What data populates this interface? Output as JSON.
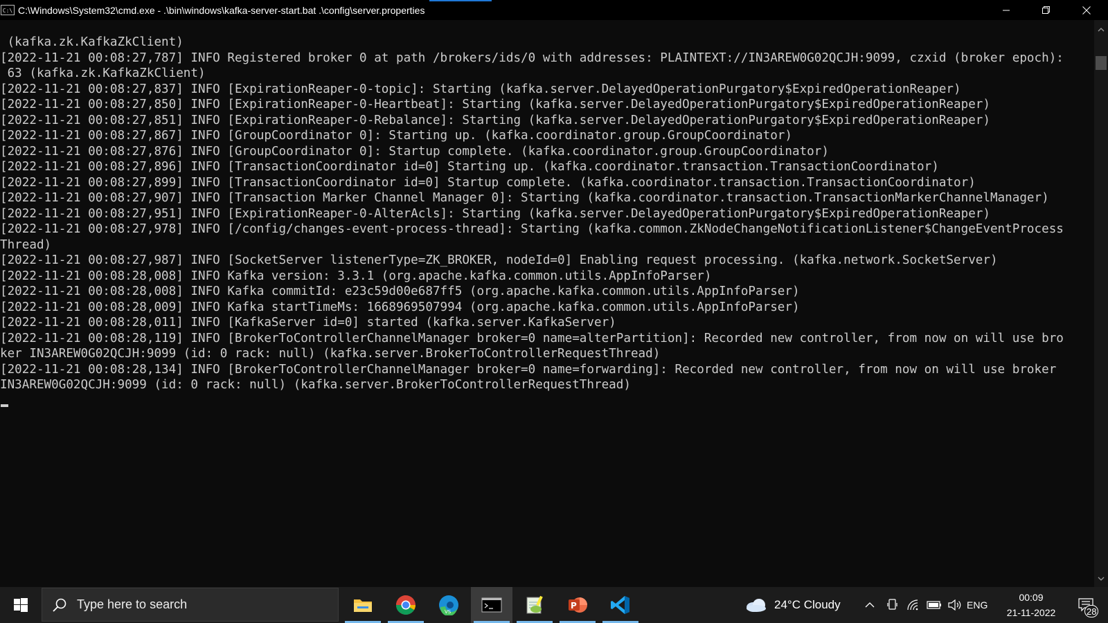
{
  "window": {
    "title": "C:\\Windows\\System32\\cmd.exe - .\\bin\\windows\\kafka-server-start.bat  .\\config\\server.properties",
    "icon_text": "C:\\"
  },
  "terminal": {
    "text": " (kafka.zk.KafkaZkClient)\n[2022-11-21 00:08:27,787] INFO Registered broker 0 at path /brokers/ids/0 with addresses: PLAINTEXT://IN3AREW0G02QCJH:9099, czxid (broker epoch):\n 63 (kafka.zk.KafkaZkClient)\n[2022-11-21 00:08:27,837] INFO [ExpirationReaper-0-topic]: Starting (kafka.server.DelayedOperationPurgatory$ExpiredOperationReaper)\n[2022-11-21 00:08:27,850] INFO [ExpirationReaper-0-Heartbeat]: Starting (kafka.server.DelayedOperationPurgatory$ExpiredOperationReaper)\n[2022-11-21 00:08:27,851] INFO [ExpirationReaper-0-Rebalance]: Starting (kafka.server.DelayedOperationPurgatory$ExpiredOperationReaper)\n[2022-11-21 00:08:27,867] INFO [GroupCoordinator 0]: Starting up. (kafka.coordinator.group.GroupCoordinator)\n[2022-11-21 00:08:27,876] INFO [GroupCoordinator 0]: Startup complete. (kafka.coordinator.group.GroupCoordinator)\n[2022-11-21 00:08:27,896] INFO [TransactionCoordinator id=0] Starting up. (kafka.coordinator.transaction.TransactionCoordinator)\n[2022-11-21 00:08:27,899] INFO [TransactionCoordinator id=0] Startup complete. (kafka.coordinator.transaction.TransactionCoordinator)\n[2022-11-21 00:08:27,907] INFO [Transaction Marker Channel Manager 0]: Starting (kafka.coordinator.transaction.TransactionMarkerChannelManager)\n[2022-11-21 00:08:27,951] INFO [ExpirationReaper-0-AlterAcls]: Starting (kafka.server.DelayedOperationPurgatory$ExpiredOperationReaper)\n[2022-11-21 00:08:27,978] INFO [/config/changes-event-process-thread]: Starting (kafka.common.ZkNodeChangeNotificationListener$ChangeEventProcess\nThread)\n[2022-11-21 00:08:27,987] INFO [SocketServer listenerType=ZK_BROKER, nodeId=0] Enabling request processing. (kafka.network.SocketServer)\n[2022-11-21 00:08:28,008] INFO Kafka version: 3.3.1 (org.apache.kafka.common.utils.AppInfoParser)\n[2022-11-21 00:08:28,008] INFO Kafka commitId: e23c59d00e687ff5 (org.apache.kafka.common.utils.AppInfoParser)\n[2022-11-21 00:08:28,009] INFO Kafka startTimeMs: 1668969507994 (org.apache.kafka.common.utils.AppInfoParser)\n[2022-11-21 00:08:28,011] INFO [KafkaServer id=0] started (kafka.server.KafkaServer)\n[2022-11-21 00:08:28,119] INFO [BrokerToControllerChannelManager broker=0 name=alterPartition]: Recorded new controller, from now on will use bro\nker IN3AREW0G02QCJH:9099 (id: 0 rack: null) (kafka.server.BrokerToControllerRequestThread)\n[2022-11-21 00:08:28,134] INFO [BrokerToControllerChannelManager broker=0 name=forwarding]: Recorded new controller, from now on will use broker\nIN3AREW0G02QCJH:9099 (id: 0 rack: null) (kafka.server.BrokerToControllerRequestThread)"
  },
  "taskbar": {
    "search_placeholder": "Type here to search",
    "weather": "24°C  Cloudy",
    "language": "ENG",
    "time": "00:09",
    "date": "21-11-2022",
    "notification_count": "28",
    "apps": [
      {
        "name": "file-explorer",
        "icon": "folder-icon"
      },
      {
        "name": "chrome",
        "icon": "chrome-icon"
      },
      {
        "name": "edge",
        "icon": "edge-icon"
      },
      {
        "name": "command-prompt",
        "icon": "terminal-icon",
        "active": true
      },
      {
        "name": "notepad-plus-plus",
        "icon": "notepad-icon"
      },
      {
        "name": "powerpoint",
        "icon": "powerpoint-icon"
      },
      {
        "name": "vscode",
        "icon": "vscode-icon"
      }
    ]
  },
  "colors": {
    "terminal_bg": "#0c0c0c",
    "terminal_fg": "#cccccc",
    "taskbar_bg": "#1c1c1c",
    "accent": "#76b9ed"
  }
}
